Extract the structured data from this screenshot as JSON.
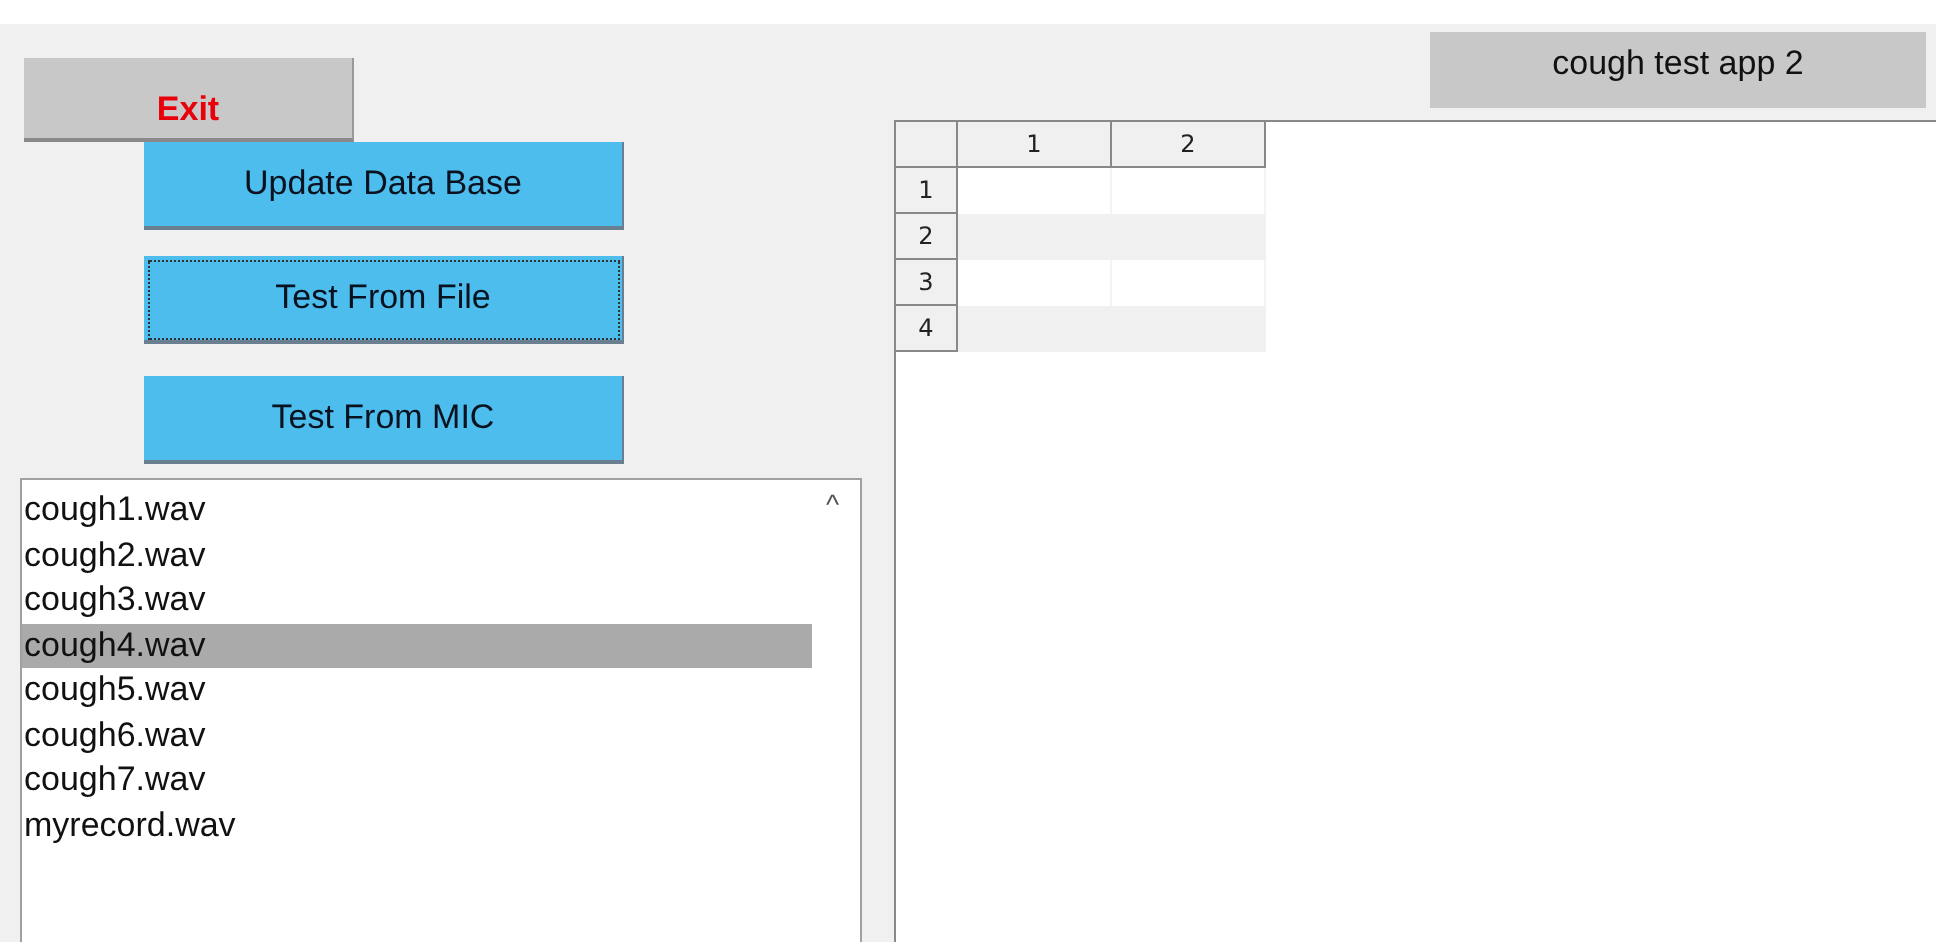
{
  "exit_button": {
    "label": "Exit"
  },
  "buttons": [
    {
      "label": "Update Data Base",
      "focused": false
    },
    {
      "label": "Test From File",
      "focused": true
    },
    {
      "label": "Test From MIC",
      "focused": false
    }
  ],
  "file_list": {
    "items": [
      {
        "label": "cough1.wav",
        "selected": false
      },
      {
        "label": "cough2.wav",
        "selected": false
      },
      {
        "label": "cough3.wav",
        "selected": false
      },
      {
        "label": "cough4.wav",
        "selected": true
      },
      {
        "label": "cough5.wav",
        "selected": false
      },
      {
        "label": "cough6.wav",
        "selected": false
      },
      {
        "label": "cough7.wav",
        "selected": false
      },
      {
        "label": "myrecord.wav",
        "selected": false
      }
    ],
    "scroll_arrow": "^"
  },
  "app_title": "cough test app 2",
  "table": {
    "columns": [
      "1",
      "2"
    ],
    "rows": [
      "1",
      "2",
      "3",
      "4"
    ]
  }
}
